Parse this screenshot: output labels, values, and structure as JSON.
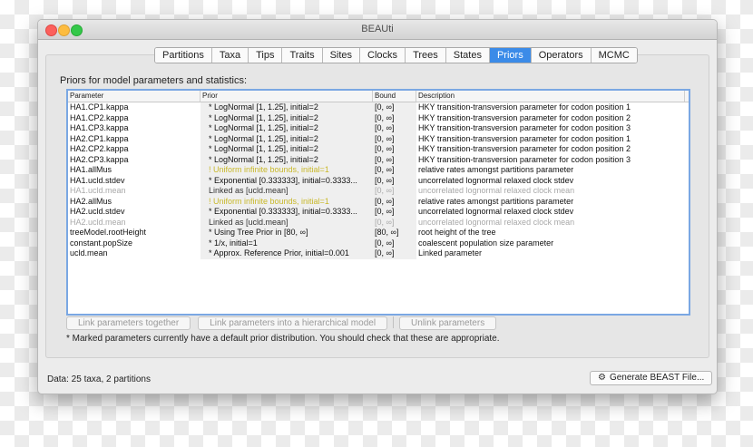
{
  "window": {
    "title": "BEAUti"
  },
  "tabs": [
    "Partitions",
    "Taxa",
    "Tips",
    "Traits",
    "Sites",
    "Clocks",
    "Trees",
    "States",
    "Priors",
    "Operators",
    "MCMC"
  ],
  "active_tab": "Priors",
  "panel": {
    "label": "Priors for model parameters and statistics:"
  },
  "table": {
    "headers": [
      "Parameter",
      "Prior",
      "Bound",
      "Description"
    ],
    "rows": [
      {
        "parameter": "HA1.CP1.kappa",
        "prior": "* LogNormal [1, 1.25], initial=2",
        "bound": "[0, ∞]",
        "description": "HKY transition-transversion parameter for codon position 1",
        "state": "normal"
      },
      {
        "parameter": "HA1.CP2.kappa",
        "prior": "* LogNormal [1, 1.25], initial=2",
        "bound": "[0, ∞]",
        "description": "HKY transition-transversion parameter for codon position 2",
        "state": "normal"
      },
      {
        "parameter": "HA1.CP3.kappa",
        "prior": "* LogNormal [1, 1.25], initial=2",
        "bound": "[0, ∞]",
        "description": "HKY transition-transversion parameter for codon position 3",
        "state": "normal"
      },
      {
        "parameter": "HA2.CP1.kappa",
        "prior": "* LogNormal [1, 1.25], initial=2",
        "bound": "[0, ∞]",
        "description": "HKY transition-transversion parameter for codon position 1",
        "state": "normal"
      },
      {
        "parameter": "HA2.CP2.kappa",
        "prior": "* LogNormal [1, 1.25], initial=2",
        "bound": "[0, ∞]",
        "description": "HKY transition-transversion parameter for codon position 2",
        "state": "normal"
      },
      {
        "parameter": "HA2.CP3.kappa",
        "prior": "* LogNormal [1, 1.25], initial=2",
        "bound": "[0, ∞]",
        "description": "HKY transition-transversion parameter for codon position 3",
        "state": "normal"
      },
      {
        "parameter": "HA1.allMus",
        "prior": "! Uniform infinite bounds, initial=1",
        "bound": "[0, ∞]",
        "description": "relative rates amongst partitions parameter",
        "state": "warning"
      },
      {
        "parameter": "HA1.ucld.stdev",
        "prior": "* Exponential [0.333333], initial=0.3333...",
        "bound": "[0, ∞]",
        "description": "uncorrelated lognormal relaxed clock stdev",
        "state": "normal"
      },
      {
        "parameter": "HA1.ucld.mean",
        "prior": "Linked as [ucld.mean]",
        "bound": "[0, ∞]",
        "description": "uncorrelated lognormal relaxed clock mean",
        "state": "disabled"
      },
      {
        "parameter": "HA2.allMus",
        "prior": "! Uniform infinite bounds, initial=1",
        "bound": "[0, ∞]",
        "description": "relative rates amongst partitions parameter",
        "state": "warning"
      },
      {
        "parameter": "HA2.ucld.stdev",
        "prior": "* Exponential [0.333333], initial=0.3333...",
        "bound": "[0, ∞]",
        "description": "uncorrelated lognormal relaxed clock stdev",
        "state": "normal"
      },
      {
        "parameter": "HA2.ucld.mean",
        "prior": "Linked as [ucld.mean]",
        "bound": "[0, ∞]",
        "description": "uncorrelated lognormal relaxed clock mean",
        "state": "disabled"
      },
      {
        "parameter": "treeModel.rootHeight",
        "prior": "* Using Tree Prior in [80, ∞]",
        "bound": "[80, ∞]",
        "description": "root height of the tree",
        "state": "normal"
      },
      {
        "parameter": "constant.popSize",
        "prior": "* 1/x, initial=1",
        "bound": "[0, ∞]",
        "description": "coalescent population size parameter",
        "state": "normal"
      },
      {
        "parameter": "ucld.mean",
        "prior": "* Approx. Reference Prior, initial=0.001",
        "bound": "[0, ∞]",
        "description": "Linked parameter",
        "state": "normal"
      }
    ]
  },
  "buttons": {
    "link_together": "Link parameters together",
    "link_hierarchical": "Link parameters into a hierarchical model",
    "unlink": "Unlink parameters"
  },
  "note": "* Marked parameters currently have a default prior distribution. You should check that these are appropriate.",
  "status": "Data: 25 taxa, 2 partitions",
  "generate_button": "Generate BEAST File...",
  "icons": {
    "generate": "gear-icon"
  }
}
